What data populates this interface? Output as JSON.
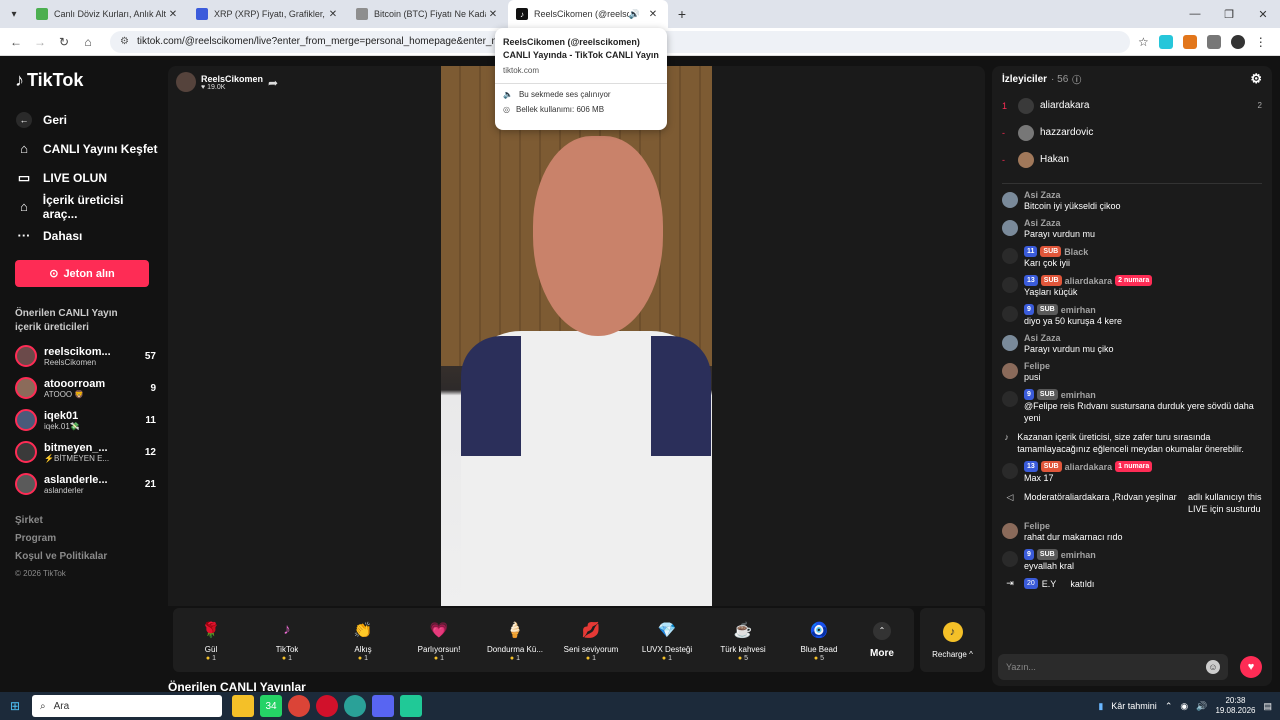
{
  "browser": {
    "tabs": [
      {
        "title": "Canlı Döviz Kurları, Anlık Altın F",
        "fav_color": "#4caf50"
      },
      {
        "title": "XRP (XRP) Fiyatı, Grafikler, Piyas",
        "fav_color": "#3b5bdb"
      },
      {
        "title": "Bitcoin (BTC) Fiyatı Ne Kadar? C",
        "fav_color": "#8e8e8e"
      },
      {
        "title": "ReelsCikomen (@reelscikomen)",
        "fav_color": "#111111"
      }
    ],
    "url": "tiktok.com/@reelscikomen/live?enter_from_merge=personal_homepage&enter_method=",
    "tooltip": {
      "title": "ReelsCikomen (@reelscikomen) CANLI Yayında - TikTok CANLI Yayın",
      "domain": "tiktok.com",
      "audio": "Bu sekmede ses çalınıyor",
      "memory": "Bellek kullanımı: 606 MB"
    }
  },
  "sidebar": {
    "logo": "TikTok",
    "back": "Geri",
    "nav": [
      {
        "label": "CANLI Yayını Keşfet",
        "icon": "home-icon"
      },
      {
        "label": "LIVE OLUN",
        "icon": "camera-icon"
      },
      {
        "label": "İçerik üreticisi araç...",
        "icon": "creator-tools-icon"
      },
      {
        "label": "Dahası",
        "icon": "more-icon"
      }
    ],
    "jeton": "Jeton alın",
    "suggested_title": "Önerilen CANLI Yayın içerik üreticileri",
    "creators": [
      {
        "name": "reelscikom...",
        "sub": "ReelsCikomen",
        "count": "57"
      },
      {
        "name": "atooorroam",
        "sub": "ATOOO 🦁",
        "count": "9"
      },
      {
        "name": "iqek01",
        "sub": "iqek.01💸",
        "count": "11"
      },
      {
        "name": "bitmeyen_...",
        "sub": "⚡BİTMEYEN E...",
        "count": "12"
      },
      {
        "name": "aslanderle...",
        "sub": "aslanderler",
        "count": "21"
      }
    ],
    "footer": [
      "Şirket",
      "Program",
      "Koşul ve Politikalar"
    ],
    "copyright": "© 2026 TikTok"
  },
  "stage": {
    "host_name": "ReelsCikomen",
    "host_likes": "♥ 19.0K",
    "recommended": "Önerilen CANLI Yayınlar"
  },
  "gifts": [
    {
      "name": "Gül",
      "price": "1",
      "icon": "🌹"
    },
    {
      "name": "TikTok",
      "price": "1",
      "icon": "♪"
    },
    {
      "name": "Alkış",
      "price": "1",
      "icon": "👏"
    },
    {
      "name": "Parlıyorsun!",
      "price": "1",
      "icon": "💗"
    },
    {
      "name": "Dondurma Kü...",
      "price": "1",
      "icon": "🍦"
    },
    {
      "name": "Seni seviyorum",
      "price": "1",
      "icon": "💋"
    },
    {
      "name": "LUVX Desteği",
      "price": "1",
      "icon": "💎"
    },
    {
      "name": "Türk kahvesi",
      "price": "5",
      "icon": "☕"
    },
    {
      "name": "Blue Bead",
      "price": "5",
      "icon": "🧿"
    }
  ],
  "more_label": "More",
  "recharge_label": "Recharge ^",
  "chat": {
    "viewers_label": "İzleyiciler",
    "viewers_count": "· 56",
    "top_viewers": [
      {
        "rank": "1",
        "name": "aliardakara",
        "score": "2"
      },
      {
        "rank": "-",
        "name": "hazzardovic",
        "score": ""
      },
      {
        "rank": "-",
        "name": "Hakan",
        "score": ""
      }
    ],
    "messages": [
      {
        "user": "Asi Zaza",
        "badges": [],
        "text": "Bitcoin iyi yükseldi çikoo"
      },
      {
        "user": "Asi Zaza",
        "badges": [],
        "text": "Parayı vurdun mu"
      },
      {
        "user": "Black",
        "badges": [
          "11",
          "SUB"
        ],
        "text": "Karı çok iyii"
      },
      {
        "user": "aliardakara",
        "badges": [
          "13",
          "SUB",
          "2 numara"
        ],
        "text": "Yaşları küçük"
      },
      {
        "user": "emirhan",
        "badges": [
          "9",
          "SUB"
        ],
        "text": "diyo ya 50 kuruşa 4 kere"
      },
      {
        "user": "Asi Zaza",
        "badges": [],
        "text": "Parayı vurdun mu çiko"
      },
      {
        "user": "Felipe",
        "badges": [],
        "text": "pusi"
      },
      {
        "user": "emirhan",
        "badges": [
          "9",
          "SUB"
        ],
        "text": "@Felipe reis Rıdvanı sustursana durduk yere sövdü daha yeni"
      }
    ],
    "system_msg": "Kazanan içerik üreticisi, size zafer turu sırasında tamamlayacağınız eğlenceli meydan okumalar önerebilir.",
    "messages2": [
      {
        "user": "aliardakara",
        "badges": [
          "13",
          "SUB",
          "1 numara"
        ],
        "text": "Max 17"
      }
    ],
    "mod_msg": "Moderatöraliardakara ,Rıdvan yeşilnar",
    "mod_msg2": "adlı kullanıcıyı this LIVE için susturdu",
    "messages3": [
      {
        "user": "Felipe",
        "badges": [],
        "text": "rahat dur makarnacı rıdo"
      },
      {
        "user": "emirhan",
        "badges": [
          "9",
          "SUB"
        ],
        "text": "eyvallah kral"
      }
    ],
    "joined": "E.Y",
    "joined_level": "20",
    "joined_text": "katıldı",
    "input_placeholder": "Yazın..."
  },
  "taskbar": {
    "search": "Ara",
    "weather": "Kâr tahmini",
    "time": "20:38",
    "date": "19.08.2026",
    "whatsapp_badge": "34"
  }
}
